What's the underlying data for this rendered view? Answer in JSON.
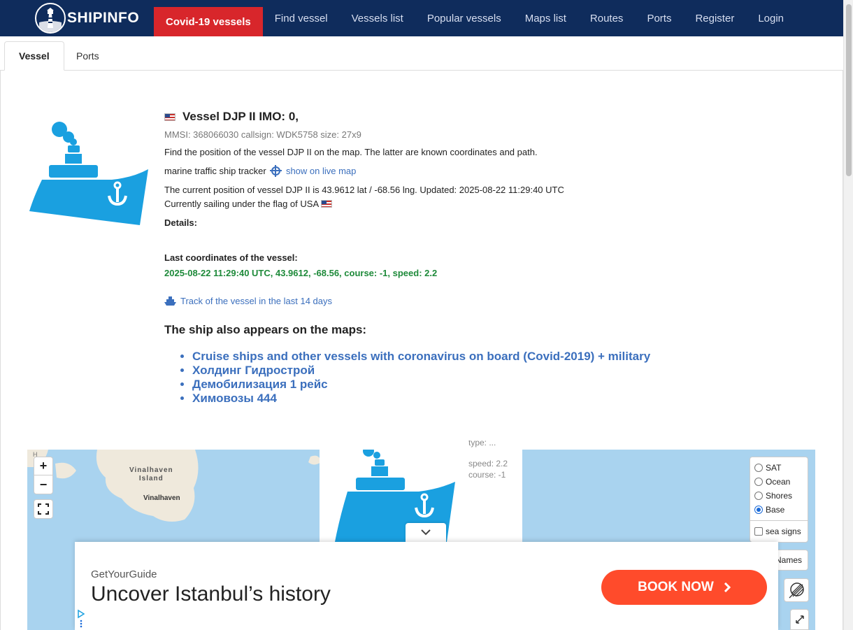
{
  "nav": {
    "brand": "SHIPINFO",
    "items": [
      {
        "label": "Covid-19 vessels",
        "active": true
      },
      {
        "label": "Find vessel"
      },
      {
        "label": "Vessels list"
      },
      {
        "label": "Popular vessels"
      },
      {
        "label": "Maps list"
      },
      {
        "label": "Routes"
      },
      {
        "label": "Ports"
      },
      {
        "label": "Register"
      },
      {
        "label": "Login"
      }
    ]
  },
  "tabs": {
    "vessel": "Vessel",
    "ports": "Ports"
  },
  "vessel": {
    "title": "Vessel DJP II IMO: 0,",
    "meta": "MMSI: 368066030 callsign: WDK5758 size: 27x9",
    "description": "Find the position of the vessel DJP II on the map. The latter are known coordinates and path.",
    "tracker_label": "marine traffic ship tracker",
    "live_map_link": "show on live map",
    "position_text": "The current position of vessel DJP II is 43.9612 lat / -68.56 lng. Updated: 2025-08-22 11:29:40 UTC",
    "flag_text": "Currently sailing under the flag of USA",
    "details_label": "Details:",
    "last_coords_label": "Last coordinates of the vessel:",
    "last_coords_value": "2025-08-22 11:29:40 UTC, 43.9612, -68.56, course: -1, speed: 2.2",
    "track_link": "Track of the vessel in the last 14 days",
    "maps_title": "The ship also appears on the maps:",
    "maps": [
      "Cruise ships and other vessels with coronavirus on board (Covid-2019) + military",
      "Холдинг Гидрострой",
      "Демобилизация 1 рейс",
      "Химовозы 444"
    ]
  },
  "map": {
    "zoom_in": "+",
    "zoom_out": "−",
    "labels": {
      "island": "Vinalhaven\nIsland",
      "town": "Vinalhaven",
      "fragment": "H"
    },
    "popup": {
      "speed": "speed: 2.2",
      "course": "course: -1",
      "cut_line": "type: ..."
    },
    "layers": [
      {
        "label": "SAT",
        "checked": false
      },
      {
        "label": "Ocean",
        "checked": false
      },
      {
        "label": "Shores",
        "checked": false
      },
      {
        "label": "Base",
        "checked": true
      }
    ],
    "sea_signs": "sea signs",
    "names": "Names"
  },
  "ad": {
    "brand": "GetYourGuide",
    "headline": "Uncover Istanbul’s history",
    "cta": "BOOK NOW"
  },
  "colors": {
    "nav_bg": "#0f2c5c",
    "accent_red": "#d8262b",
    "ship_blue": "#1aa0e0",
    "link": "#3b6fbd",
    "green": "#1e8a3a",
    "ad_button": "#ff4b2b",
    "sea": "#a9d3ef",
    "land": "#efe9dc"
  }
}
